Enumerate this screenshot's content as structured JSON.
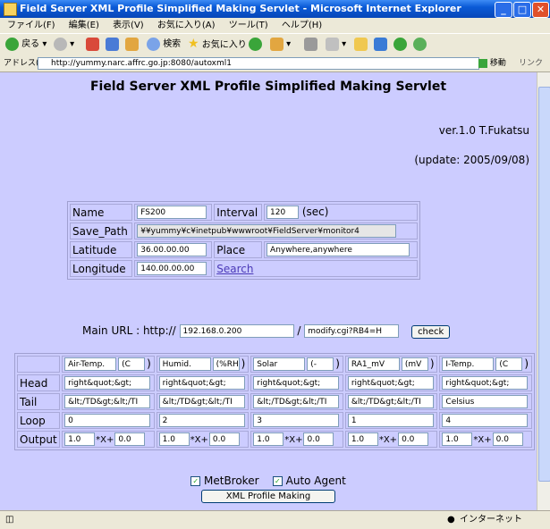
{
  "window": {
    "title": "Field Server XML Profile Simplified Making Servlet - Microsoft Internet Explorer",
    "menu": [
      "ファイル(F)",
      "編集(E)",
      "表示(V)",
      "お気に入り(A)",
      "ツール(T)",
      "ヘルプ(H)"
    ],
    "toolbar": {
      "back": "戻る",
      "search": "検索",
      "favorites": "お気に入り"
    },
    "address_label": "アドレス(D)",
    "address": "http://yummy.narc.affrc.go.jp:8080/autoxml1",
    "go": "移動",
    "links": "リンク",
    "status_zone": "インターネット"
  },
  "page": {
    "title": "Field Server XML Profile Simplified Making Servlet",
    "version": "ver.1.0 T.Fukatsu",
    "update": "(update: 2005/09/08)",
    "form": {
      "name_label": "Name",
      "name_value": "FS200",
      "interval_label": "Interval",
      "interval_value": "120",
      "interval_unit": "(sec)",
      "save_path_label": "Save_Path",
      "save_path_value": "¥¥yummy¥c¥inetpub¥wwwroot¥FieldServer¥monitor4",
      "latitude_label": "Latitude",
      "latitude_value": "36.00.00.00",
      "place_label": "Place",
      "place_value": "Anywhere,anywhere",
      "longitude_label": "Longitude",
      "longitude_value": "140.00.00.00",
      "search_link": "Search"
    },
    "main_url": {
      "label": "Main URL : http://",
      "host": "192.168.0.200",
      "slash": "/",
      "path": "modify.cgi?RB4=H",
      "check": "check"
    },
    "sensor_table": {
      "row_labels": [
        "Head",
        "Tail",
        "Loop",
        "Output"
      ],
      "columns": [
        {
          "name": "Air-Temp.",
          "unit": "(C",
          "close": ")",
          "head": "right&quot;&gt;",
          "tail": "&lt;/TD&gt;&lt;/TI",
          "loop": "0",
          "out_a": "1.0",
          "out_b": "0.0"
        },
        {
          "name": "Humid.",
          "unit": "(%RH",
          "close": ")",
          "head": "right&quot;&gt;",
          "tail": "&lt;/TD&gt;&lt;/TI",
          "loop": "2",
          "out_a": "1.0",
          "out_b": "0.0"
        },
        {
          "name": "Solar",
          "unit": "(-",
          "close": ")",
          "head": "right&quot;&gt;",
          "tail": "&lt;/TD&gt;&lt;/TI",
          "loop": "3",
          "out_a": "1.0",
          "out_b": "0.0"
        },
        {
          "name": "RA1_mV",
          "unit": "(mV",
          "close": ")",
          "head": "right&quot;&gt;",
          "tail": "&lt;/TD&gt;&lt;/TI",
          "loop": "1",
          "out_a": "1.0",
          "out_b": "0.0"
        },
        {
          "name": "I-Temp.",
          "unit": "(C",
          "close": ")",
          "head": "right&quot;&gt;",
          "tail": "Celsius",
          "loop": "4",
          "out_a": "1.0",
          "out_b": "0.0"
        }
      ],
      "mult": "*X+"
    },
    "metbroker_label": "MetBroker",
    "autoagent_label": "Auto Agent",
    "submit": "XML Profile Making"
  }
}
